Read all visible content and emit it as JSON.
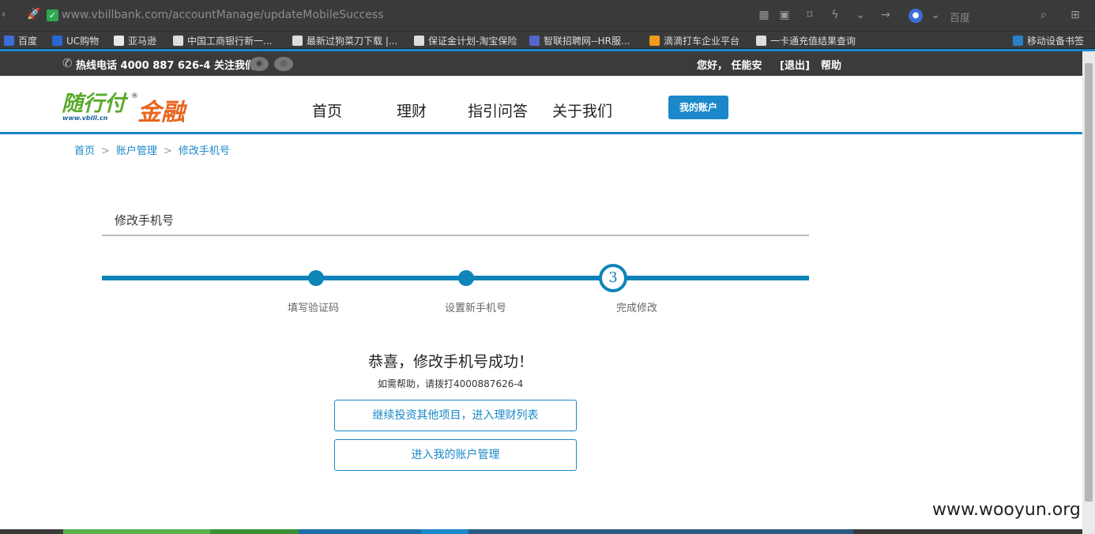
{
  "browser": {
    "url": "www.vbillbank.com/accountManage/updateMobileSuccess",
    "search_placeholder": "百度",
    "bookmarks": [
      {
        "label": "百度",
        "icon": "baidu-icon",
        "color": "#3b6ed8"
      },
      {
        "label": "UC购物",
        "icon": "uc-icon",
        "color": "#2b67d0"
      },
      {
        "label": "亚马逊",
        "icon": "amazon-icon",
        "color": "#e8e8e8"
      },
      {
        "label": "中国工商银行新一...",
        "icon": "page-icon",
        "color": "#ddd"
      },
      {
        "label": "最新过狗菜刀下载 |...",
        "icon": "page-icon",
        "color": "#ddd"
      },
      {
        "label": "保证金计划-淘宝保险",
        "icon": "page-icon",
        "color": "#ddd"
      },
      {
        "label": "智联招聘网--HR服...",
        "icon": "zhaopin-icon",
        "color": "#5566cc"
      },
      {
        "label": "滴滴打车企业平台",
        "icon": "didi-icon",
        "color": "#f39c1a"
      },
      {
        "label": "一卡通充值结果查询",
        "icon": "page-icon",
        "color": "#ddd"
      }
    ],
    "mobile_bookmarks": "移动设备书签"
  },
  "topbar": {
    "hotline": "热线电话  4000 887 626-4 关注我们",
    "greeting": "您好，  任能安",
    "logout": "[退出]",
    "help": "帮助"
  },
  "header": {
    "logo_text": "随行付",
    "logo_sub": "金融",
    "logo_url": "www.vbill.cn",
    "nav": [
      "首页",
      "理财",
      "指引问答",
      "关于我们"
    ],
    "my_account": "我的账户"
  },
  "breadcrumb": {
    "items": [
      "首页",
      "账户管理",
      "修改手机号"
    ],
    "separator": ">"
  },
  "main": {
    "section_title": "修改手机号",
    "steps": [
      "填写验证码",
      "设置新手机号",
      "完成修改"
    ],
    "current_step_number": "3",
    "success_message": "恭喜，修改手机号成功！",
    "help_text": "如需帮助，请拨打4000887626-4",
    "button_continue": "继续投资其他项目，进入理财列表",
    "button_account": "进入我的账户管理"
  },
  "watermark": "www.wooyun.org",
  "colors": {
    "accent": "#1a88c9",
    "progress": "#0e84b8",
    "topbar": "#3b3b3b"
  }
}
